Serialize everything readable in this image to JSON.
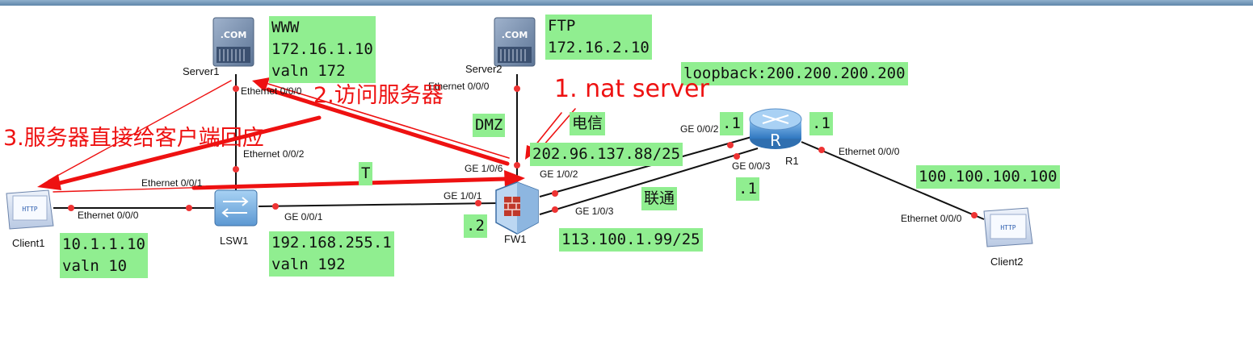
{
  "devices": {
    "server1": "Server1",
    "server2": "Server2",
    "client1": "Client1",
    "client2": "Client2",
    "lsw1": "LSW1",
    "fw1": "FW1",
    "r1": "R1"
  },
  "icons": {
    "com": ".COM",
    "http": "HTTP",
    "router": "R"
  },
  "notes": {
    "www": "WWW\n172.16.1.10\nvaln 172",
    "ftp": "FTP\n172.16.2.10",
    "loopback": "loopback:200.200.200.200",
    "dmz": "DMZ",
    "telecom": "电信",
    "telecom_ip": "202.96.137.88/25",
    "r1_g002": ".1",
    "r1_top": ".1",
    "r1_g003": ".1",
    "trust": "T",
    "unicom": "联通",
    "unicom_ip": "113.100.1.99/25",
    "fw_g101": ".2",
    "client2_ip": "100.100.100.100",
    "client1_ip": "10.1.1.10\nvaln 10",
    "lsw_ip": "192.168.255.1\nvaln 192"
  },
  "ports": {
    "s1_e000": "Ethernet 0/0/0",
    "s2_e000": "Ethernet 0/0/0",
    "lsw_e002": "Ethernet 0/0/2",
    "lsw_e001": "Ethernet 0/0/1",
    "c1_e000": "Ethernet 0/0/0",
    "lsw_ge001": "GE 0/0/1",
    "fw_ge101": "GE 1/0/1",
    "fw_ge106": "GE 1/0/6",
    "fw_ge102": "GE 1/0/2",
    "fw_ge103": "GE 1/0/3",
    "r1_ge002": "GE 0/0/2",
    "r1_ge003": "GE 0/0/3",
    "r1_e000": "Ethernet 0/0/0",
    "c2_e000": "Ethernet 0/0/0"
  },
  "annotations": {
    "step1": "1. nat server",
    "step2": "2.访问服务器",
    "step3": "3.服务器直接给客户端回应"
  },
  "colors": {
    "note_bg": "#90ee90",
    "arrow": "#ee1111",
    "link": "#111111",
    "port_dot": "#ee3333"
  }
}
